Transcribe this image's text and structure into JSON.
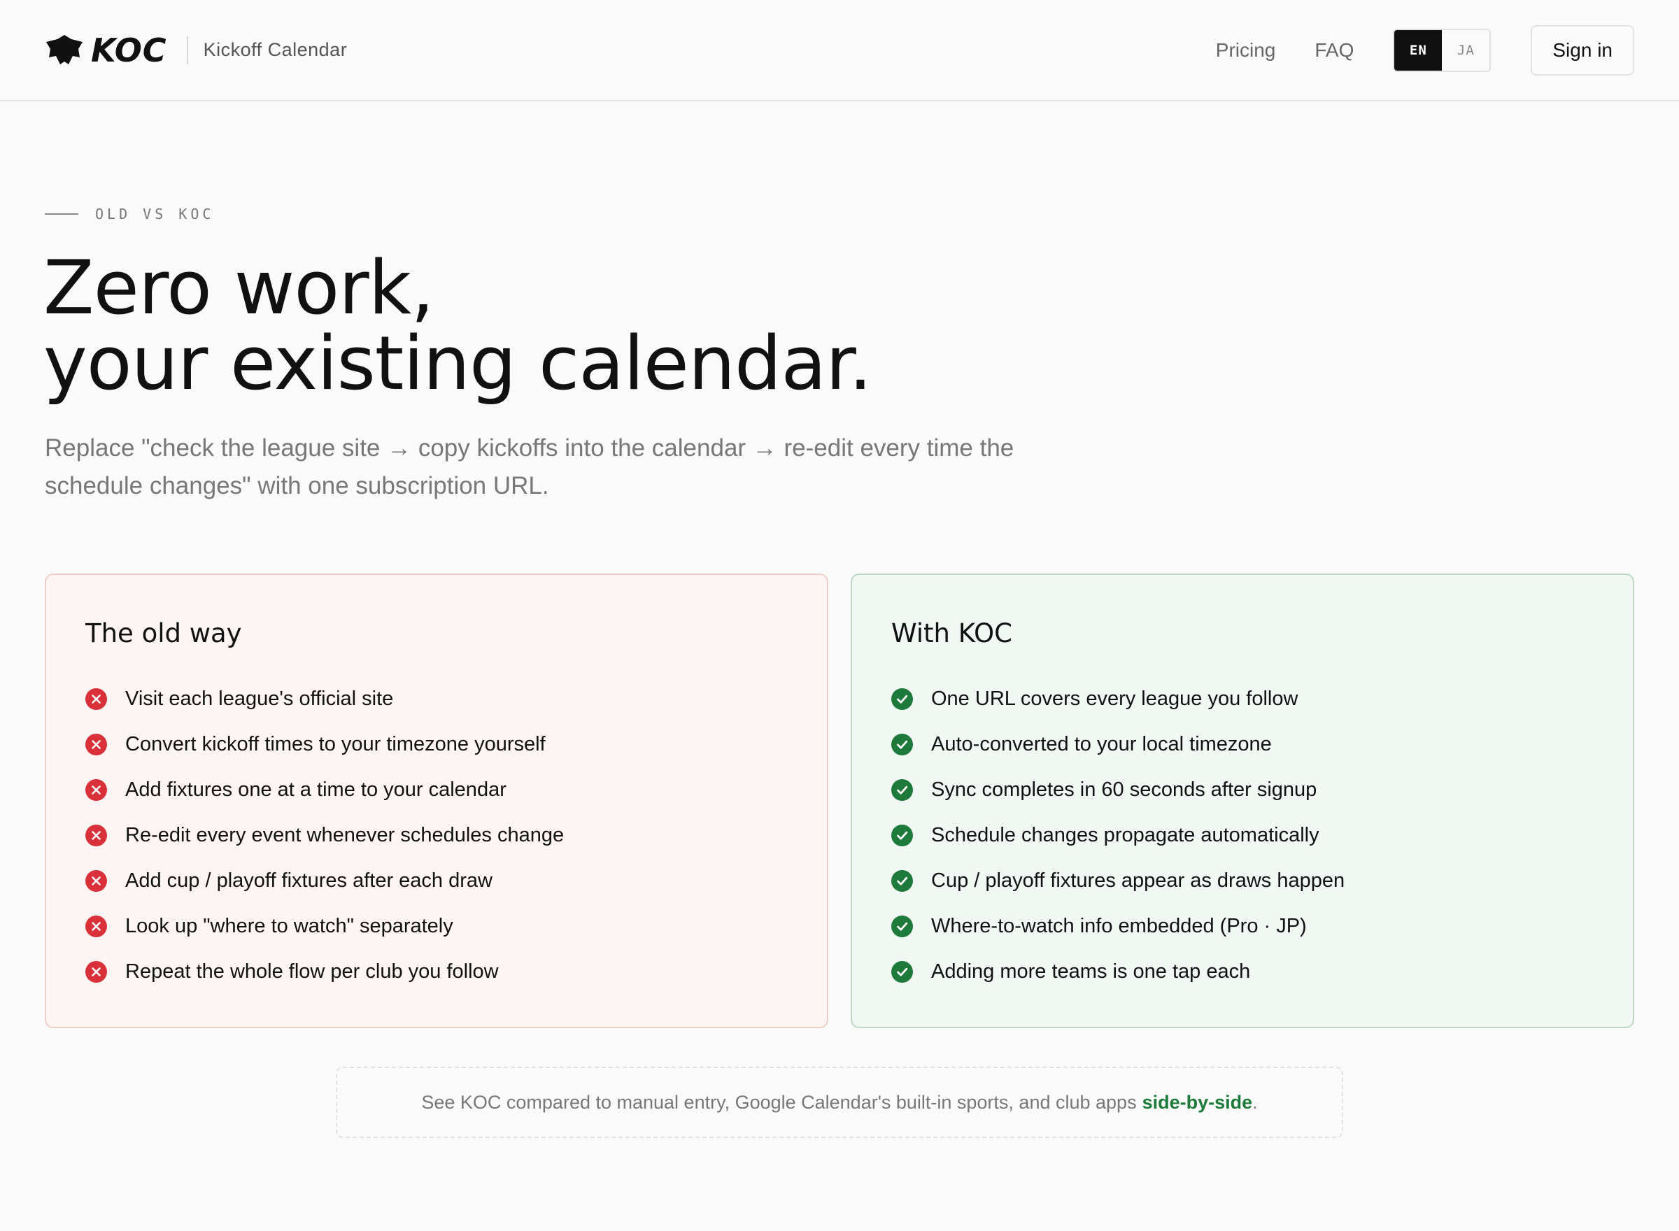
{
  "header": {
    "brand": "KOC",
    "brand_sub": "Kickoff Calendar",
    "nav": {
      "pricing": "Pricing",
      "faq": "FAQ"
    },
    "lang": {
      "en": "EN",
      "ja": "JA",
      "selected": "EN"
    },
    "signin": "Sign in"
  },
  "hero": {
    "eyebrow": "OLD VS KOC",
    "title_line1": "Zero work,",
    "title_line2": "your existing calendar.",
    "lede": "Replace \"check the league site → copy kickoffs into the calendar → re-edit every time the schedule changes\" with one subscription URL."
  },
  "old_way": {
    "title": "The old way",
    "icon": "x-circle-icon",
    "items": [
      "Visit each league's official site",
      "Convert kickoff times to your timezone yourself",
      "Add fixtures one at a time to your calendar",
      "Re-edit every event whenever schedules change",
      "Add cup / playoff fixtures after each draw",
      "Look up \"where to watch\" separately",
      "Repeat the whole flow per club you follow"
    ]
  },
  "with_koc": {
    "title": "With KOC",
    "icon": "check-circle-icon",
    "items": [
      "One URL covers every league you follow",
      "Auto-converted to your local timezone",
      "Sync completes in 60 seconds after signup",
      "Schedule changes propagate automatically",
      "Cup / playoff fixtures appear as draws happen",
      "Where-to-watch info embedded (Pro · JP)",
      "Adding more teams is one tap each"
    ]
  },
  "footnote": {
    "text": "See KOC compared to manual entry, Google Calendar's built-in sports, and club apps",
    "link": "side-by-side",
    "end": "."
  },
  "colors": {
    "accent_green": "#1d7a3a",
    "error_red": "#d9303a",
    "old_card_bg": "#fdf5f3",
    "new_card_bg": "#f1f7f2"
  }
}
